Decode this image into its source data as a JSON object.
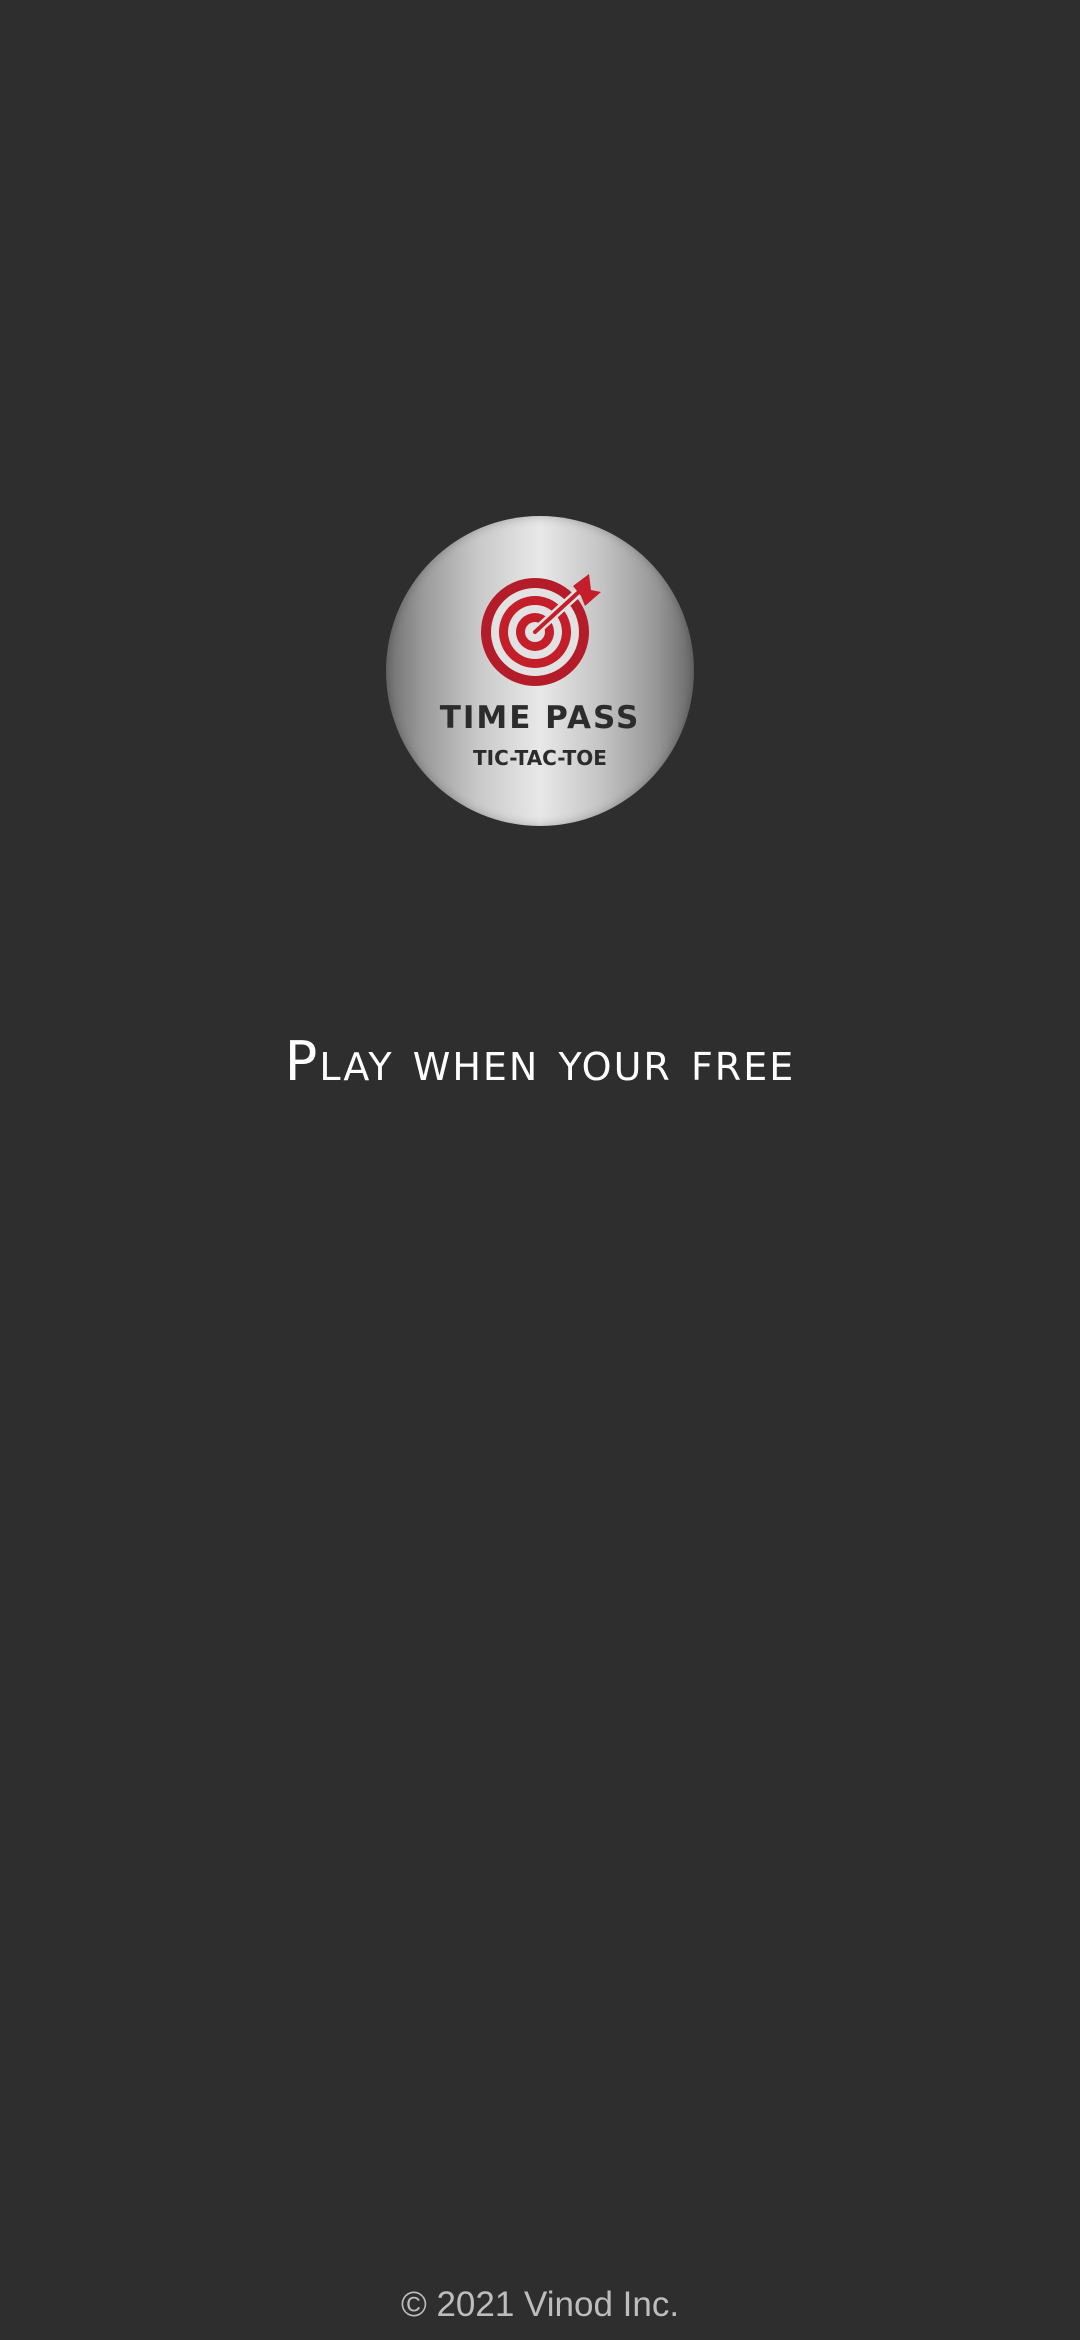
{
  "logo": {
    "title": "TIME PASS",
    "subtitle": "TIC-TAC-TOE",
    "icon": "target-icon",
    "icon_color": "#c41e2a"
  },
  "tagline": "Play when your free",
  "footer": {
    "copyright": "© 2021 Vinod Inc."
  },
  "colors": {
    "background": "#2e2e2e",
    "tagline": "#ffffff",
    "footer": "#bdbdbd"
  }
}
